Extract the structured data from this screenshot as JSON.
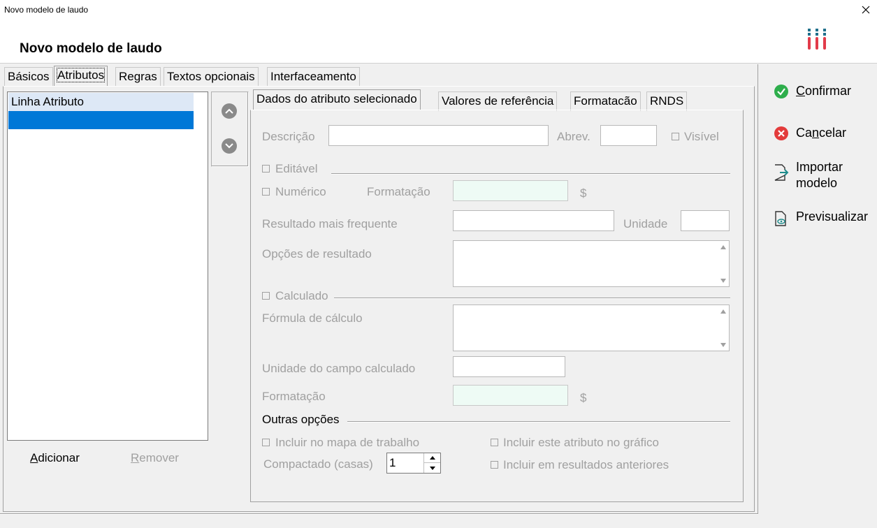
{
  "window": {
    "title": "Novo modelo de laudo",
    "close_icon": "×"
  },
  "header": {
    "title": "Novo modelo de laudo",
    "logo": "test-tubes-icon"
  },
  "main_tabs": [
    {
      "label": "Básicos"
    },
    {
      "label": "Atributos"
    },
    {
      "label": "Regras"
    },
    {
      "label": "Textos opcionais"
    },
    {
      "label": "Interfaceamento"
    }
  ],
  "attribute_list": {
    "items": [
      {
        "label": "Linha Atributo"
      },
      {
        "label": ""
      }
    ],
    "add_label_pre": "",
    "add_label_u": "A",
    "add_label_post": "dicionar",
    "remove_label_pre": "",
    "remove_label_u": "R",
    "remove_label_post": "emover"
  },
  "sub_tabs": [
    {
      "label": "Dados do atributo selecionado"
    },
    {
      "label": "Valores de referência"
    },
    {
      "label": "Formatacão"
    },
    {
      "label": "RNDS"
    }
  ],
  "form": {
    "descricao_label": "Descrição",
    "descricao_value": "",
    "abrev_label": "Abrev.",
    "abrev_value": "",
    "visivel_label": "Visível",
    "editavel_label": "Editável",
    "numerico_label": "Numérico",
    "formatacao_label": "Formatação",
    "currency_symbol": "$",
    "resultado_label": "Resultado mais frequente",
    "unidade_label": "Unidade",
    "opcoes_label": "Opções de resultado",
    "calculado_label": "Calculado",
    "formula_label": "Fórmula de cálculo",
    "unidade_calc_label": "Unidade do campo calculado",
    "formatacao2_label": "Formatação",
    "outras_label": "Outras opções",
    "incluir_mapa_label": "Incluir no mapa de trabalho",
    "compactado_label": "Compactado (casas)",
    "compactado_value": "1",
    "incluir_grafico_label": "Incluir este atributo no gráfico",
    "incluir_anteriores_label": "Incluir em resultados anteriores"
  },
  "actions": {
    "confirmar_u": "C",
    "confirmar_rest": "onfirmar",
    "cancelar_pre": "Ca",
    "cancelar_u": "n",
    "cancelar_rest": "celar",
    "importar_line1": "Importar",
    "importar_line2": "modelo",
    "previsualizar": "Previsualizar"
  },
  "colors": {
    "confirm": "#2eae4c",
    "cancel": "#e33b3b",
    "selection": "#0078d7",
    "accent_teal": "#1e8c8c"
  }
}
